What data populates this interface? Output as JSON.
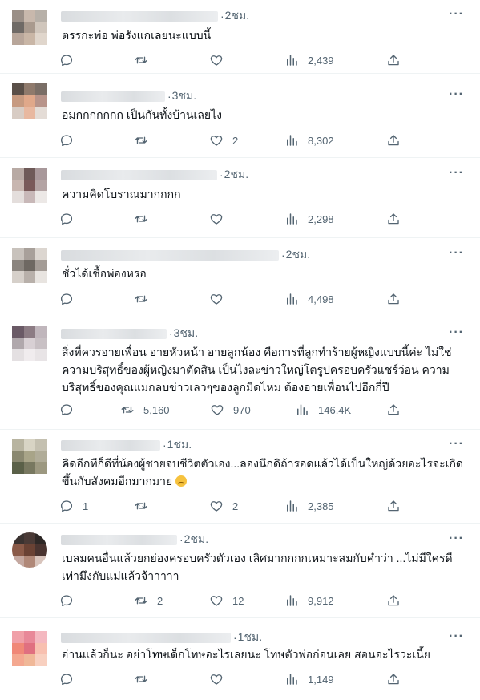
{
  "colors": {
    "icon": "#536471",
    "text": "#0f1419",
    "divider": "#eff3f4"
  },
  "icons": {
    "reply": "reply-icon",
    "retweet": "retweet-icon",
    "like": "heart-icon",
    "views": "views-icon",
    "share": "share-icon",
    "more": "more-icon"
  },
  "tweets": [
    {
      "time": "2ชม.",
      "text": "ตรรกะพ่อ พ่อรังแกเลยนะแบบนี้",
      "replies": "",
      "retweets": "",
      "likes": "",
      "views": "2,439"
    },
    {
      "time": "3ชม.",
      "text": "อมกกกกกกก เป็นกันทั้งบ้านเลยไง",
      "replies": "",
      "retweets": "",
      "likes": "2",
      "views": "8,302"
    },
    {
      "time": "2ชม.",
      "text": "ความคิดโบราณมากกกก",
      "replies": "",
      "retweets": "",
      "likes": "",
      "views": "2,298"
    },
    {
      "time": "2ชม.",
      "text": "ชั่วได้เชื้อพ่องหรอ",
      "replies": "",
      "retweets": "",
      "likes": "",
      "views": "4,498"
    },
    {
      "time": "3ชม.",
      "text": "สิ่งที่ควรอายเพื่อน อายหัวหน้า อายลูกน้อง คือการที่ลูกทำร้ายผู้หญิงแบบนี้ค่ะ ไม่ใช่ความบริสุทธิ์ของผู้หญิงมาตัดสิน เป็นไงละข่าวใหญ่โตรูปครอบครัวแชร์ว่อน ความบริสุทธิ์ของคุณแม่กลบข่าวเลวๆของลูกมิดไหม ต้องอายเพื่อนไปอีกกี่ปี",
      "replies": "",
      "retweets": "5,160",
      "likes": "970",
      "views": "146.4K"
    },
    {
      "time": "1ชม.",
      "text": "คิดอีกทีก็ดีที่น้องผู้ชายจบชีวิตตัวเอง...ลองนึกดิถ้ารอดแล้วได้เป็นใหญ่ด้วยอะไรจะเกิดขึ้นกับสังคมอีกมากมาย",
      "replies": "1",
      "retweets": "",
      "likes": "2",
      "views": "2,385"
    },
    {
      "time": "2ชม.",
      "text": "เบลมคนอื่นแล้วยกย่องครอบครัวตัวเอง เลิศมากกกกเหมาะสมกับคำว่า ...ไม่มีใครดีเท่ามึงกับแม่แล้วจ้าาาาา",
      "replies": "",
      "retweets": "2",
      "likes": "12",
      "views": "9,912"
    },
    {
      "time": "1ชม.",
      "text": "อ่านแล้วก็นะ อย่าโทษเด็กโทษอะไรเลยนะ โทษตัวพ่อก่อนเลย สอนอะไรวะเนี้ย",
      "replies": "",
      "retweets": "",
      "likes": "",
      "views": "1,149"
    }
  ]
}
